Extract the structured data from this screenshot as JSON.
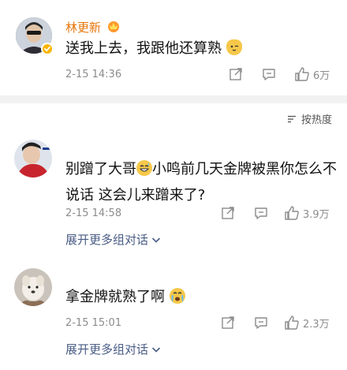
{
  "comment1": {
    "author": "林更新",
    "content_text": "送我上去，我跟他还算熟",
    "time": "2-15 14:36",
    "likes": "6万"
  },
  "sort": {
    "label": "按热度"
  },
  "comment2": {
    "content_part1": "别蹭了大哥",
    "content_part2": "小鸣前几天金牌被黑你怎么不说话 这会儿来蹭来了?",
    "time": "2-15 14:58",
    "likes": "3.9万",
    "expand_label": "展开更多组对话"
  },
  "comment3": {
    "content_text": "拿金牌就熟了啊",
    "time": "2-15 15:01",
    "likes": "2.3万",
    "expand_label": "展开更多组对话"
  },
  "colors": {
    "author_name": "#e8750a",
    "expand_link": "#4a5d86",
    "meta_text": "#8c8c8c",
    "separator": "#f2f2f2"
  },
  "icons": [
    "share-icon",
    "comment-icon",
    "like-icon",
    "sort-icon",
    "chevron-down-icon",
    "verified-badge-icon"
  ]
}
